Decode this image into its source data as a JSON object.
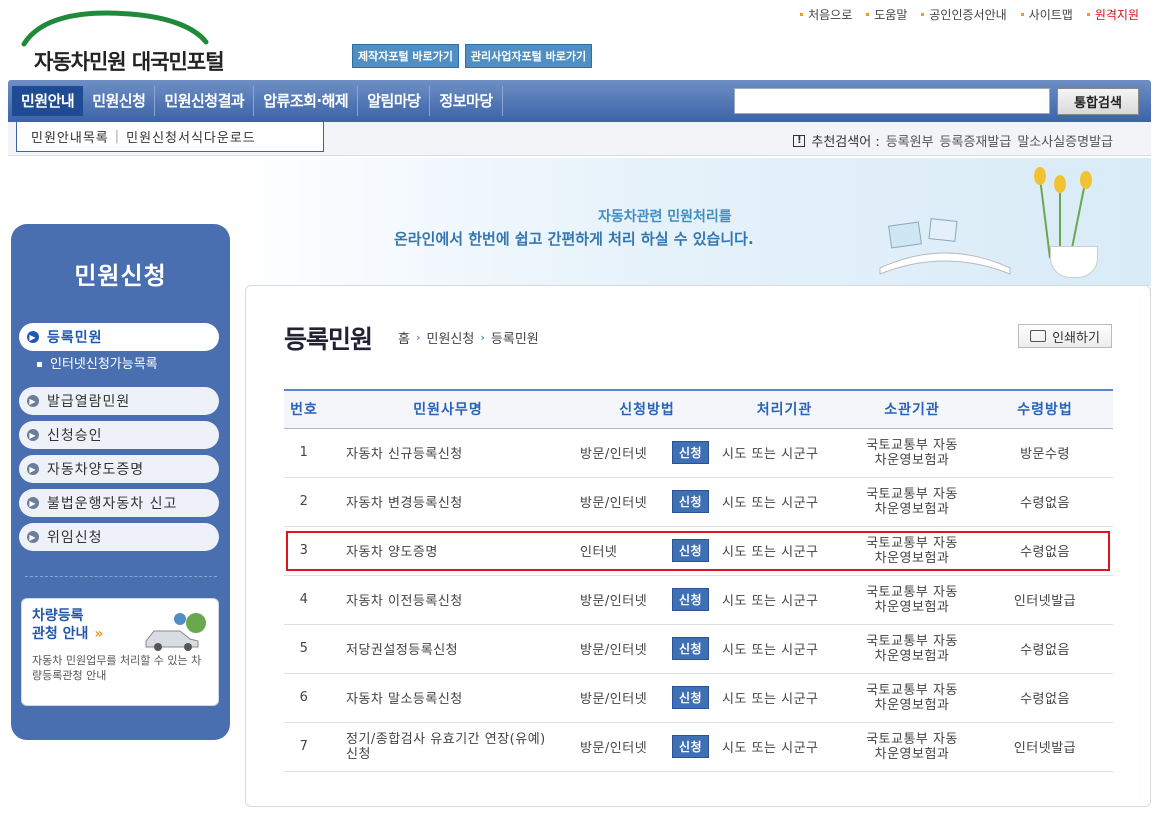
{
  "utility_links": [
    "처음으로",
    "도움말",
    "공인인증서안내",
    "사이트맵",
    "원격지원"
  ],
  "logo_text": "자동차민원 대국민포털",
  "portal_buttons": [
    "제작자포털 바로가기",
    "관리사업자포털 바로가기"
  ],
  "nav": {
    "items": [
      "민원안내",
      "민원신청",
      "민원신청결과",
      "압류조회·해제",
      "알림마당",
      "정보마당"
    ],
    "search_value": "",
    "search_button": "통합검색"
  },
  "subnav": {
    "tabs": [
      "민원안내목록",
      "민원신청서식다운로드"
    ],
    "rec_label": "추천검색어 :",
    "rec_terms": [
      "등록원부",
      "등록증재발급",
      "말소사실증명발급"
    ]
  },
  "banner": {
    "line1": "자동차관련 민원처리를",
    "line2": "온라인에서 한번에 쉽고 간편하게 처리 하실 수 있습니다."
  },
  "sidebar": {
    "title": "민원신청",
    "items": [
      "등록민원",
      "발급열람민원",
      "신청승인",
      "자동차양도증명",
      "불법운행자동차 신고",
      "위임신청"
    ],
    "sub_item": "인터넷신청가능목록",
    "promo_title_1": "차량등록",
    "promo_title_2": "관청 안내",
    "promo_arrow": "»",
    "promo_desc": "자동차 민원업무를 처리할 수 있는 차량등록관청 안내"
  },
  "page": {
    "title": "등록민원",
    "breadcrumb": [
      "홈",
      "민원신청",
      "등록민원"
    ],
    "print_label": "인쇄하기"
  },
  "table": {
    "headers": [
      "번호",
      "민원사무명",
      "신청방법",
      "처리기관",
      "소관기관",
      "수령방법"
    ],
    "apply_label": "신청",
    "rows": [
      {
        "no": "1",
        "name": "자동차 신규등록신청",
        "method": "방문/인터넷",
        "proc": "시도 또는 시군구",
        "own1": "국토교통부 자동",
        "own2": "차운영보험과",
        "receive": "방문수령"
      },
      {
        "no": "2",
        "name": "자동차 변경등록신청",
        "method": "방문/인터넷",
        "proc": "시도 또는 시군구",
        "own1": "국토교통부 자동",
        "own2": "차운영보험과",
        "receive": "수령없음"
      },
      {
        "no": "3",
        "name": "자동차 양도증명",
        "method": "인터넷",
        "proc": "시도 또는 시군구",
        "own1": "국토교통부 자동",
        "own2": "차운영보험과",
        "receive": "수령없음"
      },
      {
        "no": "4",
        "name": "자동차 이전등록신청",
        "method": "방문/인터넷",
        "proc": "시도 또는 시군구",
        "own1": "국토교통부 자동",
        "own2": "차운영보험과",
        "receive": "인터넷발급"
      },
      {
        "no": "5",
        "name": "저당권설정등록신청",
        "method": "방문/인터넷",
        "proc": "시도 또는 시군구",
        "own1": "국토교통부 자동",
        "own2": "차운영보험과",
        "receive": "수령없음"
      },
      {
        "no": "6",
        "name": "자동차 말소등록신청",
        "method": "방문/인터넷",
        "proc": "시도 또는 시군구",
        "own1": "국토교통부 자동",
        "own2": "차운영보험과",
        "receive": "수령없음"
      },
      {
        "no": "7",
        "name": "정기/종합검사 유효기간 연장(유예)신청",
        "method": "방문/인터넷",
        "proc": "시도 또는 시군구",
        "own1": "국토교통부 자동",
        "own2": "차운영보험과",
        "receive": "인터넷발급"
      }
    ]
  },
  "highlighted_row": "3",
  "colors": {
    "nav": "#3c63a8",
    "sidebar": "#4a6fb0",
    "highlight": "#e0141c",
    "header_text": "#2a63b8"
  }
}
